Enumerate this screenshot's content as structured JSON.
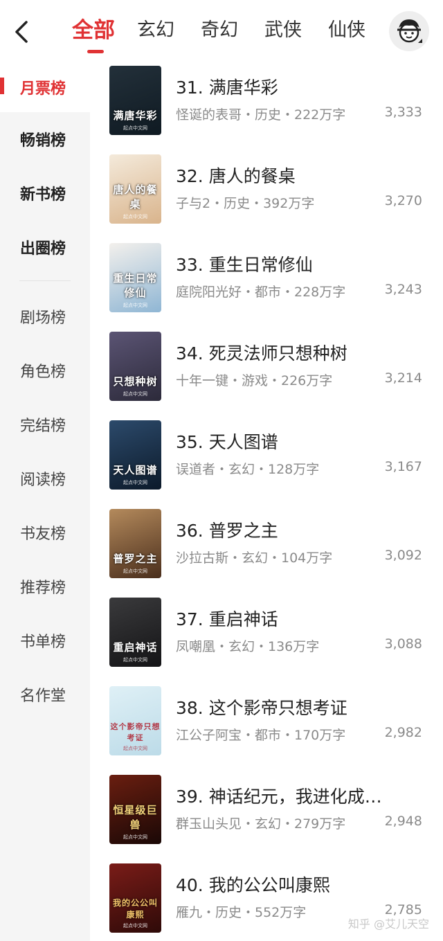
{
  "header": {
    "tabs": [
      {
        "label": "全部",
        "active": true
      },
      {
        "label": "玄幻",
        "active": false
      },
      {
        "label": "奇幻",
        "active": false
      },
      {
        "label": "武侠",
        "active": false
      },
      {
        "label": "仙侠",
        "active": false
      }
    ]
  },
  "sidebar": {
    "items": [
      {
        "label": "月票榜"
      },
      {
        "label": "畅销榜"
      },
      {
        "label": "新书榜"
      },
      {
        "label": "出圈榜"
      },
      {
        "label": "剧场榜"
      },
      {
        "label": "角色榜"
      },
      {
        "label": "完结榜"
      },
      {
        "label": "阅读榜"
      },
      {
        "label": "书友榜"
      },
      {
        "label": "推荐榜"
      },
      {
        "label": "书单榜"
      },
      {
        "label": "名作堂"
      }
    ]
  },
  "books": [
    {
      "title": "31. 满唐华彩",
      "meta": "怪诞的表哥・历史・222万字",
      "count": "3,333",
      "cover_text": "满唐华彩",
      "cover_bg": "#23303a",
      "cover_bg2": "#0f1a22"
    },
    {
      "title": "32. 唐人的餐桌",
      "meta": "子与2・历史・392万字",
      "count": "3,270",
      "cover_text": "唐人的餐桌",
      "cover_bg": "#f4eadb",
      "cover_bg2": "#d9b48c"
    },
    {
      "title": "33. 重生日常修仙",
      "meta": "庭院阳光好・都市・228万字",
      "count": "3,243",
      "cover_text": "重生日常修仙",
      "cover_bg": "#f3f0ec",
      "cover_bg2": "#8fb6d4"
    },
    {
      "title": "34. 死灵法师只想种树",
      "meta": "十年一键・游戏・226万字",
      "count": "3,214",
      "cover_text": "只想种树",
      "cover_bg": "#5b5474",
      "cover_bg2": "#2c2a3a"
    },
    {
      "title": "35. 天人图谱",
      "meta": "误道者・玄幻・128万字",
      "count": "3,167",
      "cover_text": "天人图谱",
      "cover_bg": "#2c4a6b",
      "cover_bg2": "#0c1a2a"
    },
    {
      "title": "36. 普罗之主",
      "meta": "沙拉古斯・玄幻・104万字",
      "count": "3,092",
      "cover_text": "普罗之主",
      "cover_bg": "#b48a5c",
      "cover_bg2": "#4a2e1c"
    },
    {
      "title": "37. 重启神话",
      "meta": "凤嘲凰・玄幻・136万字",
      "count": "3,088",
      "cover_text": "重启神话",
      "cover_bg": "#3a3a3c",
      "cover_bg2": "#141416"
    },
    {
      "title": "38. 这个影帝只想考证",
      "meta": "江公子阿宝・都市・170万字",
      "count": "2,982",
      "cover_text": "这个影帝只想考证",
      "cover_bg": "#dff0f6",
      "cover_bg2": "#bcdbe8"
    },
    {
      "title": "39. 神话纪元，我进化成…",
      "meta": "群玉山头见・玄幻・279万字",
      "count": "2,948",
      "cover_text": "恒星级巨兽",
      "cover_bg": "#6a1e10",
      "cover_bg2": "#1a0806"
    },
    {
      "title": "40. 我的公公叫康熙",
      "meta": "雁九・历史・552万字",
      "count": "2,785",
      "cover_text": "我的公公叫康熙",
      "cover_bg": "#7a1c18",
      "cover_bg2": "#2e0a08"
    }
  ],
  "cover_publisher": "起点中文网",
  "watermark": "知乎 @艾儿天空"
}
